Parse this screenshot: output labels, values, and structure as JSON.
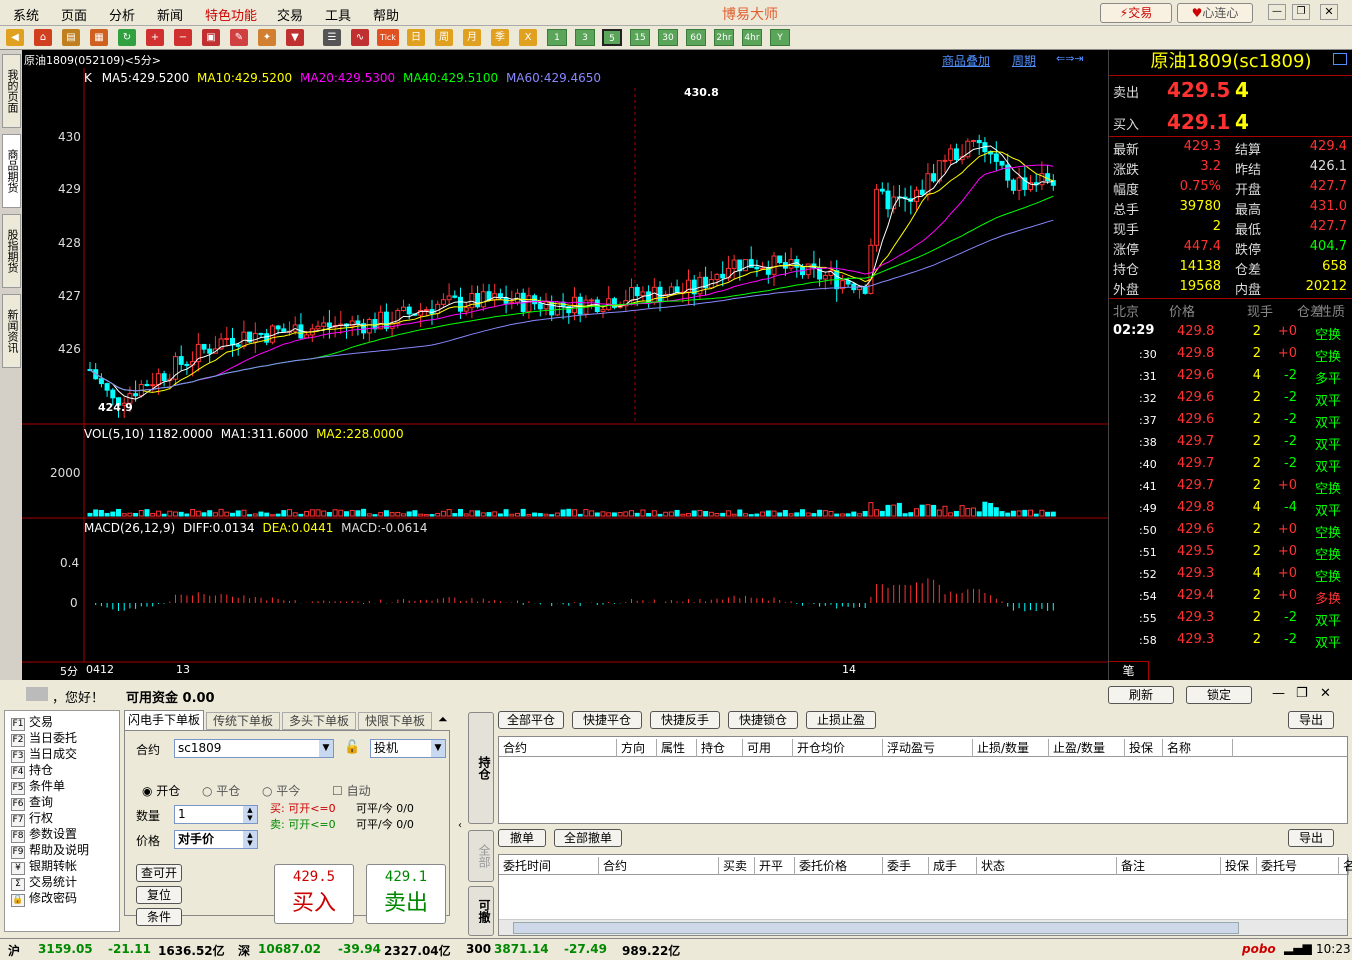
{
  "app": {
    "title": "博易大师",
    "trade_btn": "交易",
    "lianlian": "心连心"
  },
  "menu": [
    "系统",
    "页面",
    "分析",
    "新闻",
    "特色功能",
    "交易",
    "工具",
    "帮助"
  ],
  "toolbar": {
    "tick": "Tick",
    "day": "日",
    "week": "周",
    "month": "月",
    "season": "季",
    "x": "X",
    "periods": [
      "1",
      "3",
      "5",
      "15",
      "30",
      "60",
      "2hr",
      "4hr",
      "Y"
    ]
  },
  "lefttabs": [
    "我的页面",
    "商品期货",
    "股指期货",
    "新闻资讯"
  ],
  "chart": {
    "symbol_header": "原油1809(052109)<5分>",
    "overlay": "商品叠加",
    "period": "周期",
    "ma_line": {
      "k": "K",
      "ma5": "MA5:429.5200",
      "ma10": "MA10:429.5200",
      "ma20": "MA20:429.5300",
      "ma40": "MA40:429.5100",
      "ma60": "MA60:429.4650"
    },
    "high_label": "430.8",
    "low_label": "424.9",
    "yticks": [
      "430",
      "429",
      "428",
      "427",
      "426"
    ],
    "vol_line": {
      "vol": "VOL(5,10) 1182.0000",
      "ma1": "MA1:311.6000",
      "ma2": "MA2:228.0000"
    },
    "vol_tick": "2000",
    "macd_line": {
      "macd": "MACD(26,12,9)",
      "diff": "DIFF:0.0134",
      "dea": "DEA:0.0441",
      "val": "MACD:-0.0614"
    },
    "macd_ticks": [
      "0.4",
      "0"
    ],
    "xaxis": {
      "period": "5分",
      "d1": "0412",
      "d2": "13",
      "d3": "14"
    }
  },
  "quote": {
    "name": "原油1809(sc1809)",
    "sell_label": "卖出",
    "sell_price": "429.5",
    "sell_vol": "4",
    "buy_label": "买入",
    "buy_price": "429.1",
    "buy_vol": "4",
    "rows": [
      [
        "最新",
        "429.3",
        "结算",
        "429.4"
      ],
      [
        "涨跌",
        "3.2",
        "昨结",
        "426.1"
      ],
      [
        "幅度",
        "0.75%",
        "开盘",
        "427.7"
      ],
      [
        "总手",
        "39780",
        "最高",
        "431.0"
      ],
      [
        "现手",
        "2",
        "最低",
        "427.7"
      ],
      [
        "涨停",
        "447.4",
        "跌停",
        "404.7"
      ],
      [
        "持仓",
        "14138",
        "仓差",
        "658"
      ],
      [
        "外盘",
        "19568",
        "内盘",
        "20212"
      ]
    ],
    "tick_header": [
      "北京",
      "价格",
      "现手",
      "仓差",
      "性质"
    ],
    "ticks": [
      [
        "02:29",
        "429.8",
        "2",
        "+0",
        "空换"
      ],
      [
        ":30",
        "429.8",
        "2",
        "+0",
        "空换"
      ],
      [
        ":31",
        "429.6",
        "4",
        "-2",
        "多平"
      ],
      [
        ":32",
        "429.6",
        "2",
        "-2",
        "双平"
      ],
      [
        ":37",
        "429.6",
        "2",
        "-2",
        "双平"
      ],
      [
        ":38",
        "429.7",
        "2",
        "-2",
        "双平"
      ],
      [
        ":40",
        "429.7",
        "2",
        "-2",
        "双平"
      ],
      [
        ":41",
        "429.7",
        "2",
        "+0",
        "空换"
      ],
      [
        ":49",
        "429.8",
        "4",
        "-4",
        "双平"
      ],
      [
        ":50",
        "429.6",
        "2",
        "+0",
        "空换"
      ],
      [
        ":51",
        "429.5",
        "2",
        "+0",
        "空换"
      ],
      [
        ":52",
        "429.3",
        "4",
        "+0",
        "空换"
      ],
      [
        ":54",
        "429.4",
        "2",
        "+0",
        "多换"
      ],
      [
        ":55",
        "429.3",
        "2",
        "-2",
        "双平"
      ],
      [
        ":58",
        "429.3",
        "2",
        "-2",
        "双平"
      ]
    ],
    "tab": "笔"
  },
  "account": {
    "greeting": "，您好！",
    "funds": "可用资金  0.00",
    "refresh": "刷新",
    "lock": "锁定"
  },
  "nav": [
    [
      "F1",
      "交易"
    ],
    [
      "F2",
      "当日委托"
    ],
    [
      "F3",
      "当日成交"
    ],
    [
      "F4",
      "持仓"
    ],
    [
      "F5",
      "条件单"
    ],
    [
      "F6",
      "查询"
    ],
    [
      "F7",
      "行权"
    ],
    [
      "F8",
      "参数设置"
    ],
    [
      "F9",
      "帮助及说明"
    ],
    [
      "¥",
      "银期转帐"
    ],
    [
      "Σ",
      "交易统计"
    ],
    [
      "🔒",
      "修改密码"
    ]
  ],
  "order": {
    "tabs": [
      "闪电手下单板",
      "传统下单板",
      "多头下单板",
      "快限下单板"
    ],
    "contract_label": "合约",
    "contract": "sc1809",
    "hedge": "投机",
    "open": "开仓",
    "close": "平仓",
    "close_today": "平今",
    "auto": "自动",
    "qty_label": "数量",
    "qty": "1",
    "price_label": "价格",
    "price": "对手价",
    "buy_info": "买: 可开<=0",
    "buy_info2": "可平/今 0/0",
    "sell_info": "卖: 可开<=0",
    "sell_info2": "可平/今 0/0",
    "check": "查可开",
    "reset": "复位",
    "cond": "条件",
    "buy_price": "429.5",
    "buy_label": "买入",
    "sell_price": "429.1",
    "sell_label": "卖出"
  },
  "side_tabs": [
    "持仓",
    "全部",
    "可撤"
  ],
  "positions": {
    "buttons": [
      "全部平仓",
      "快捷平仓",
      "快捷反手",
      "快捷锁仓",
      "止损止盈"
    ],
    "export": "导出",
    "cols": [
      "合约",
      "方向",
      "属性",
      "持仓",
      "可用",
      "开仓均价",
      "浮动盈亏",
      "止损/数量",
      "止盈/数量",
      "投保",
      "名称"
    ]
  },
  "orders": {
    "buttons": [
      "撤单",
      "全部撤单"
    ],
    "export": "导出",
    "cols": [
      "委托时间",
      "合约",
      "买卖",
      "开平",
      "委托价格",
      "委手",
      "成手",
      "状态",
      "备注",
      "投保",
      "委托号",
      "名"
    ]
  },
  "status": {
    "sh": "沪",
    "sh_v": "3159.05",
    "sh_c": "-21.11",
    "sh_a": "1636.52亿",
    "sz": "深",
    "sz_v": "10687.02",
    "sz_c": "-39.94",
    "sz_a": "2327.04亿",
    "i300": "300",
    "i300_v": "3871.14",
    "i300_c": "-27.49",
    "i300_a": "989.22亿",
    "logo": "pobo",
    "time": "10:23"
  },
  "colors": {
    "up": "#ff3232",
    "down": "#00ffff",
    "yellow": "#ffff00",
    "green": "#00ff00"
  }
}
